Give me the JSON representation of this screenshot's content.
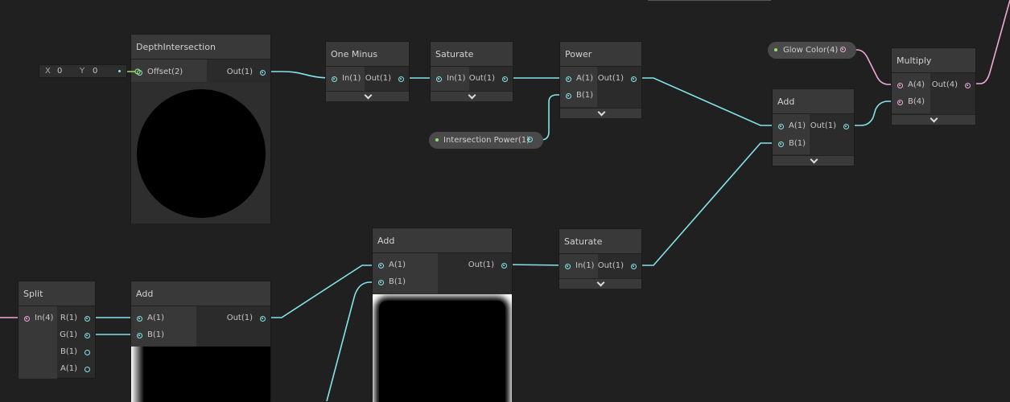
{
  "nodes": {
    "depth": {
      "title": "DepthIntersection",
      "input": "Offset(2)",
      "output": "Out(1)",
      "vector_field": {
        "x_label": "X",
        "x_value": "0",
        "y_label": "Y",
        "y_value": "0"
      }
    },
    "one_minus": {
      "title": "One Minus",
      "input": "In(1)",
      "output": "Out(1)"
    },
    "saturate1": {
      "title": "Saturate",
      "input": "In(1)",
      "output": "Out(1)"
    },
    "power": {
      "title": "Power",
      "input_a": "A(1)",
      "input_b": "B(1)",
      "output": "Out(1)"
    },
    "add_top": {
      "title": "Add",
      "input_a": "A(1)",
      "input_b": "B(1)",
      "output": "Out(1)"
    },
    "multiply": {
      "title": "Multiply",
      "input_a": "A(4)",
      "input_b": "B(4)",
      "output": "Out(4)"
    },
    "add_mid": {
      "title": "Add",
      "input_a": "A(1)",
      "input_b": "B(1)",
      "output": "Out(1)"
    },
    "saturate2": {
      "title": "Saturate",
      "input": "In(1)",
      "output": "Out(1)"
    },
    "split": {
      "title": "Split",
      "input": "In(4)",
      "outputs": [
        "R(1)",
        "G(1)",
        "B(1)",
        "A(1)"
      ]
    },
    "add_low": {
      "title": "Add",
      "input_a": "A(1)",
      "input_b": "B(1)",
      "output": "Out(1)"
    }
  },
  "properties": {
    "intersection_power": "Intersection Power(1)",
    "glow_color": "Glow Color(4)"
  },
  "colors": {
    "background": "#202020",
    "wire_float": "#84e4e7",
    "wire_vector4": "#f0a8d8",
    "property_indicator": "#96e26a"
  }
}
